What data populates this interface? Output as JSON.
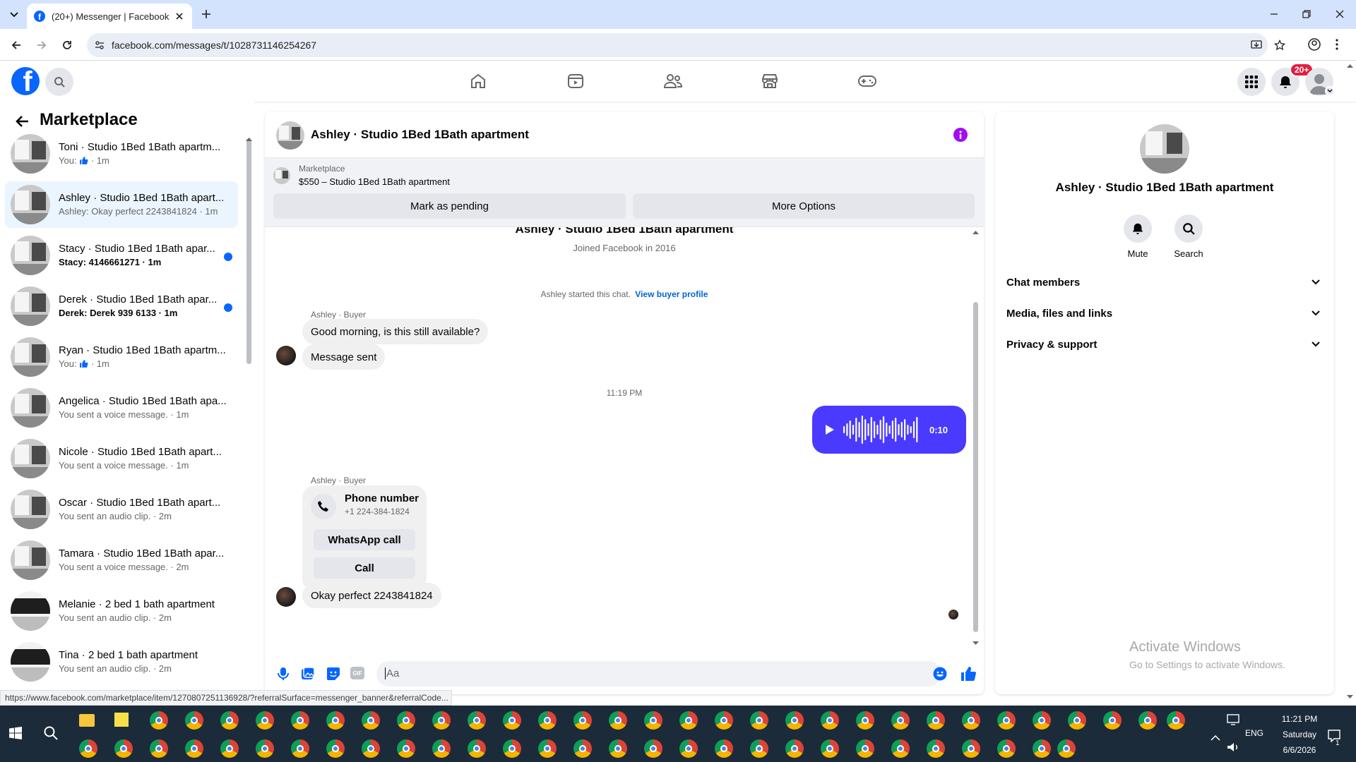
{
  "browser": {
    "tab_title": "(20+) Messenger | Facebook",
    "url": "facebook.com/messages/t/1028731146254267",
    "status_url": "https://www.facebook.com/marketplace/item/1270807251136928/?referralSurface=messenger_banner&referralCode..."
  },
  "fb": {
    "notification_badge": "20+"
  },
  "left": {
    "title": "Marketplace",
    "conversations": [
      {
        "name": "Toni · Studio 1Bed 1Bath apartm...",
        "prefix": "You:",
        "like": true,
        "time": "· 1m",
        "sub": "",
        "unread": false
      },
      {
        "name": "Ashley · Studio 1Bed 1Bath apart...",
        "prefix": "",
        "like": false,
        "time": "",
        "sub": "Ashley: Okay perfect 2243841824 · 1m",
        "unread": false,
        "active": true
      },
      {
        "name": "Stacy · Studio 1Bed 1Bath apar...",
        "prefix": "",
        "like": false,
        "time": "",
        "sub": "Stacy: 4146661271 · 1m",
        "unread": true
      },
      {
        "name": "Derek · Studio 1Bed 1Bath apar...",
        "prefix": "",
        "like": false,
        "time": "",
        "sub": "Derek: Derek 939 6133 · 1m",
        "unread": true
      },
      {
        "name": "Ryan · Studio 1Bed 1Bath apartm...",
        "prefix": "You:",
        "like": true,
        "time": "· 1m",
        "sub": "",
        "unread": false
      },
      {
        "name": "Angelica · Studio 1Bed 1Bath apa...",
        "prefix": "",
        "like": false,
        "time": "",
        "sub": "You sent a voice message. · 1m",
        "unread": false
      },
      {
        "name": "Nicole · Studio 1Bed 1Bath apart...",
        "prefix": "",
        "like": false,
        "time": "",
        "sub": "You sent a voice message. · 1m",
        "unread": false
      },
      {
        "name": "Oscar · Studio 1Bed 1Bath apart...",
        "prefix": "",
        "like": false,
        "time": "",
        "sub": "You sent an audio clip. · 2m",
        "unread": false
      },
      {
        "name": "Tamara · Studio 1Bed 1Bath apar...",
        "prefix": "",
        "like": false,
        "time": "",
        "sub": "You sent a voice message. · 2m",
        "unread": false
      },
      {
        "name": "Melanie · 2 bed 1 bath apartment",
        "prefix": "",
        "like": false,
        "time": "",
        "sub": "You sent an audio clip. · 2m",
        "unread": false
      },
      {
        "name": "Tina · 2 bed 1 bath apartment",
        "prefix": "",
        "like": false,
        "time": "",
        "sub": "You sent an audio clip. · 2m",
        "unread": false
      }
    ]
  },
  "chat": {
    "header_title": "Ashley · Studio 1Bed 1Bath apartment",
    "listing_label": "Marketplace",
    "listing_title": "$550 – Studio 1Bed 1Bath apartment",
    "mark_pending": "Mark as pending",
    "more_options": "More Options",
    "profile_name": "Ashley · Studio 1Bed 1Bath apartment",
    "joined": "Joined Facebook in 2016",
    "started_text": "Ashley started this chat.",
    "view_buyer": "View buyer profile",
    "sender_label": "Ashley · Buyer",
    "msg1": "Good morning, is this still available?",
    "msg2": "Message sent",
    "timestamp": "11:19 PM",
    "voice_duration": "0:10",
    "sender_label2": "Ashley · Buyer",
    "phone_title": "Phone number",
    "phone_number": "+1 224-384-1824",
    "whatsapp": "WhatsApp call",
    "call": "Call",
    "msg3": "Okay perfect 2243841824",
    "composer_placeholder": "Aa"
  },
  "right": {
    "name": "Ashley · Studio 1Bed 1Bath apartment",
    "mute": "Mute",
    "search": "Search",
    "sections": [
      "Chat members",
      "Media, files and links",
      "Privacy & support"
    ],
    "activate_title": "Activate Windows",
    "activate_sub": "Go to Settings to activate Windows."
  },
  "taskbar": {
    "time": "11:21 PM",
    "day": "Saturday",
    "date": "6/6/2026",
    "lang": "ENG",
    "notif_count": "1"
  },
  "colors": {
    "fb_blue": "#0866ff",
    "voice_bubble": "#4a3aff",
    "link": "#0064d1"
  }
}
